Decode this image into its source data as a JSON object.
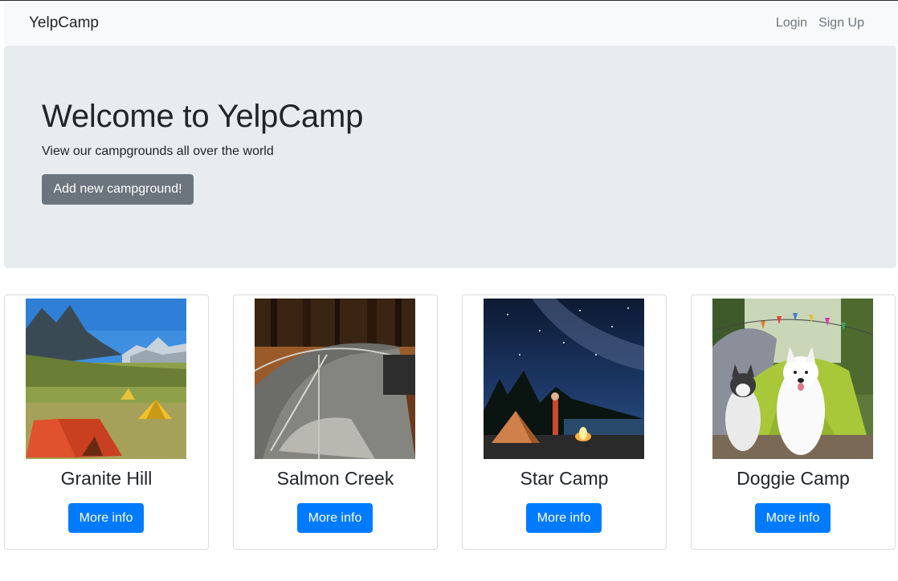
{
  "navbar": {
    "brand": "YelpCamp",
    "links": [
      {
        "label": "Login"
      },
      {
        "label": "Sign Up"
      }
    ]
  },
  "jumbotron": {
    "title": "Welcome to YelpCamp",
    "subtitle": "View our campgrounds all over the world",
    "button_label": "Add new campground!"
  },
  "colors": {
    "primary_button": "#007bff",
    "secondary_button": "#6c757d",
    "jumbotron_bg": "#e9ecef",
    "navbar_bg": "#f8f9fa"
  },
  "campgrounds": [
    {
      "name": "Granite Hill",
      "button_label": "More info",
      "image": "mountain-tents-photo"
    },
    {
      "name": "Salmon Creek",
      "button_label": "More info",
      "image": "forest-tent-photo"
    },
    {
      "name": "Star Camp",
      "button_label": "More info",
      "image": "night-sky-campfire-photo"
    },
    {
      "name": "Doggie Camp",
      "button_label": "More info",
      "image": "huskies-tent-photo"
    }
  ]
}
